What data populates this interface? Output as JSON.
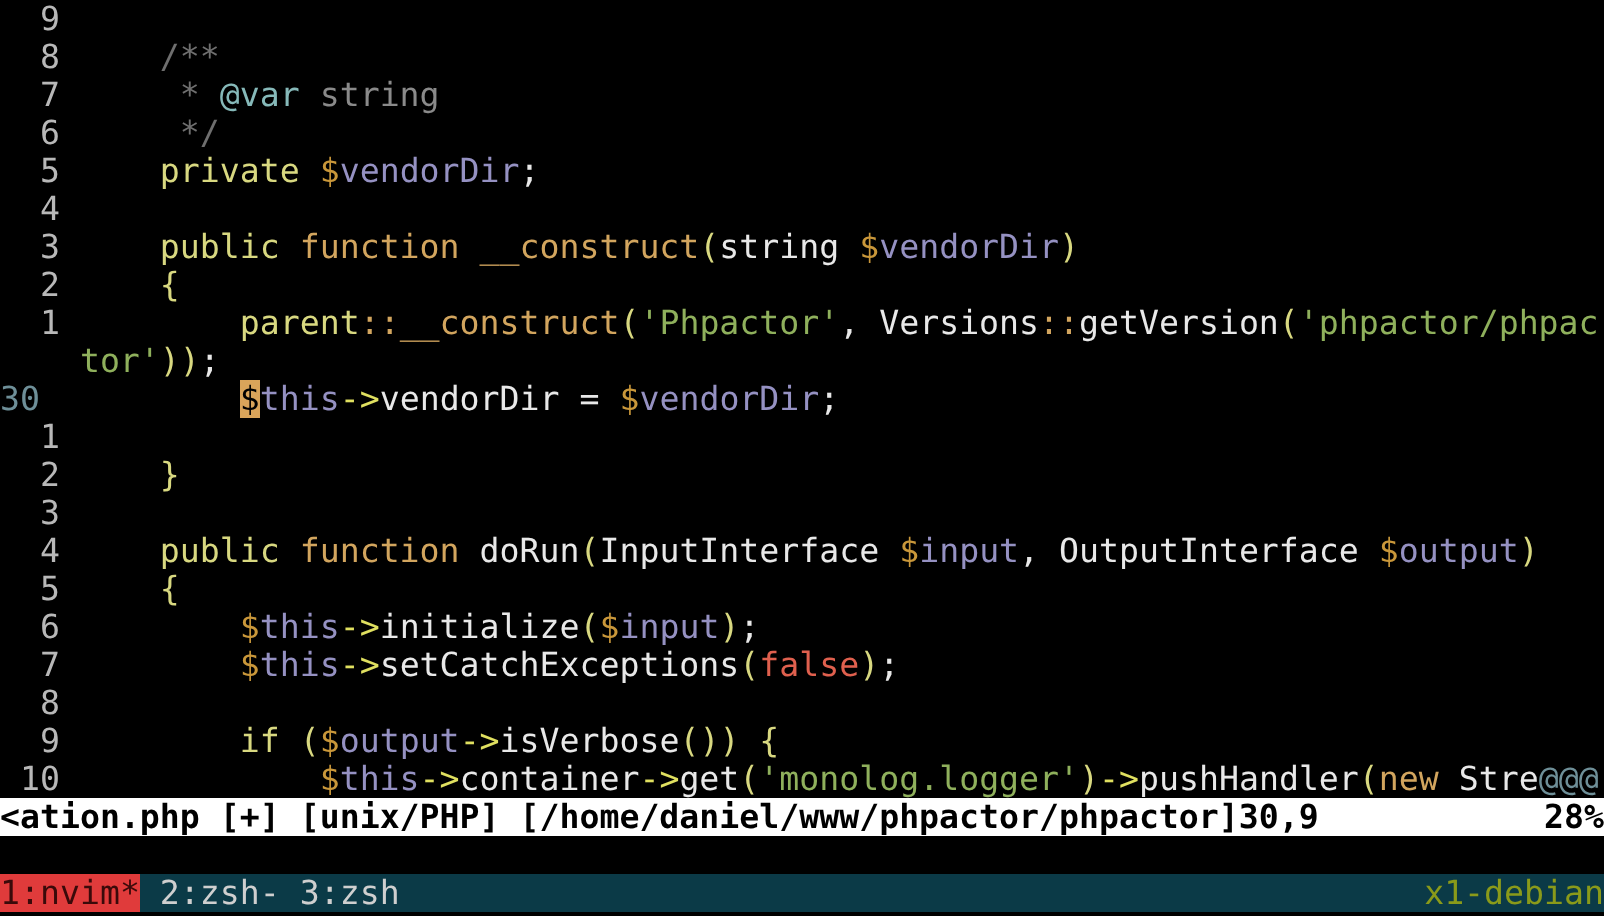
{
  "editor": {
    "lines": [
      {
        "number": "9",
        "current": false
      },
      {
        "number": "8",
        "current": false,
        "segments": [
          {
            "kind": "comment",
            "text": "    /**"
          }
        ]
      },
      {
        "number": "7",
        "current": false,
        "segments": [
          {
            "kind": "comment",
            "text": "     * "
          },
          {
            "kind": "doctag",
            "text": "@var"
          },
          {
            "kind": "doctype",
            "text": " string"
          }
        ]
      },
      {
        "number": "6",
        "current": false,
        "segments": [
          {
            "kind": "comment",
            "text": "     */"
          }
        ]
      },
      {
        "number": "5",
        "current": false,
        "segments": [
          {
            "kind": "keyword",
            "text": "    private "
          },
          {
            "kind": "sigil",
            "text": "$"
          },
          {
            "kind": "variable",
            "text": "vendorDir"
          },
          {
            "kind": "plain",
            "text": ";"
          }
        ]
      },
      {
        "number": "4",
        "current": false
      },
      {
        "number": "3",
        "current": false,
        "segments": [
          {
            "kind": "keyword",
            "text": "    public "
          },
          {
            "kind": "function",
            "text": "function __construct"
          },
          {
            "kind": "paren",
            "text": "("
          },
          {
            "kind": "plain",
            "text": "string "
          },
          {
            "kind": "sigil",
            "text": "$"
          },
          {
            "kind": "variable",
            "text": "vendorDir"
          },
          {
            "kind": "paren",
            "text": ")"
          }
        ]
      },
      {
        "number": "2",
        "current": false,
        "segments": [
          {
            "kind": "paren",
            "text": "    {"
          }
        ]
      },
      {
        "number": "1",
        "current": false,
        "segments": [
          {
            "kind": "keyword",
            "text": "        parent"
          },
          {
            "kind": "operator",
            "text": "::"
          },
          {
            "kind": "function",
            "text": "__construct"
          },
          {
            "kind": "paren",
            "text": "("
          },
          {
            "kind": "string",
            "text": "'Phpactor'"
          },
          {
            "kind": "plain",
            "text": ", Versions"
          },
          {
            "kind": "operator",
            "text": "::"
          },
          {
            "kind": "plain",
            "text": "getVersion"
          },
          {
            "kind": "paren",
            "text": "("
          },
          {
            "kind": "string",
            "text": "'phpactor/phpac"
          }
        ]
      },
      {
        "segments": [
          {
            "kind": "string",
            "text": "tor'"
          },
          {
            "kind": "paren",
            "text": "))"
          },
          {
            "kind": "plain",
            "text": ";"
          }
        ]
      },
      {
        "number": "30",
        "current": true,
        "segments": [
          {
            "kind": "sigil",
            "text": "        $",
            "cursor": true
          },
          {
            "kind": "variable",
            "text": "this"
          },
          {
            "kind": "arrow",
            "text": "->"
          },
          {
            "kind": "plain",
            "text": "vendorDir = "
          },
          {
            "kind": "sigil",
            "text": "$"
          },
          {
            "kind": "variable",
            "text": "vendorDir"
          },
          {
            "kind": "plain",
            "text": ";"
          }
        ]
      },
      {
        "number": "1",
        "current": false
      },
      {
        "number": "2",
        "current": false,
        "segments": [
          {
            "kind": "paren",
            "text": "    }"
          }
        ]
      },
      {
        "number": "3",
        "current": false
      },
      {
        "number": "4",
        "current": false,
        "segments": [
          {
            "kind": "keyword",
            "text": "    public "
          },
          {
            "kind": "function",
            "text": "function "
          },
          {
            "kind": "plain",
            "text": "doRun"
          },
          {
            "kind": "paren",
            "text": "("
          },
          {
            "kind": "plain",
            "text": "InputInterface "
          },
          {
            "kind": "sigil",
            "text": "$"
          },
          {
            "kind": "variable",
            "text": "input"
          },
          {
            "kind": "plain",
            "text": ", OutputInterface "
          },
          {
            "kind": "sigil",
            "text": "$"
          },
          {
            "kind": "variable",
            "text": "output"
          },
          {
            "kind": "paren",
            "text": ")"
          }
        ]
      },
      {
        "number": "5",
        "current": false,
        "segments": [
          {
            "kind": "paren",
            "text": "    {"
          }
        ]
      },
      {
        "number": "6",
        "current": false,
        "segments": [
          {
            "kind": "sigil",
            "text": "        $"
          },
          {
            "kind": "variable",
            "text": "this"
          },
          {
            "kind": "arrow",
            "text": "->"
          },
          {
            "kind": "plain",
            "text": "initialize"
          },
          {
            "kind": "paren",
            "text": "("
          },
          {
            "kind": "sigil",
            "text": "$"
          },
          {
            "kind": "variable",
            "text": "input"
          },
          {
            "kind": "paren",
            "text": ")"
          },
          {
            "kind": "plain",
            "text": ";"
          }
        ]
      },
      {
        "number": "7",
        "current": false,
        "segments": [
          {
            "kind": "sigil",
            "text": "        $"
          },
          {
            "kind": "variable",
            "text": "this"
          },
          {
            "kind": "arrow",
            "text": "->"
          },
          {
            "kind": "plain",
            "text": "setCatchExceptions"
          },
          {
            "kind": "paren",
            "text": "("
          },
          {
            "kind": "boolean",
            "text": "false"
          },
          {
            "kind": "paren",
            "text": ")"
          },
          {
            "kind": "plain",
            "text": ";"
          }
        ]
      },
      {
        "number": "8",
        "current": false
      },
      {
        "number": "9",
        "current": false,
        "segments": [
          {
            "kind": "keyword",
            "text": "        if "
          },
          {
            "kind": "paren",
            "text": "("
          },
          {
            "kind": "sigil",
            "text": "$"
          },
          {
            "kind": "variable",
            "text": "output"
          },
          {
            "kind": "arrow",
            "text": "->"
          },
          {
            "kind": "plain",
            "text": "isVerbose"
          },
          {
            "kind": "paren",
            "text": "()) {"
          }
        ]
      },
      {
        "number": "10",
        "current": false,
        "segments": [
          {
            "kind": "sigil",
            "text": "            $"
          },
          {
            "kind": "variable",
            "text": "this"
          },
          {
            "kind": "arrow",
            "text": "->"
          },
          {
            "kind": "plain",
            "text": "container"
          },
          {
            "kind": "arrow",
            "text": "->"
          },
          {
            "kind": "plain",
            "text": "get"
          },
          {
            "kind": "paren",
            "text": "("
          },
          {
            "kind": "string",
            "text": "'monolog.logger'"
          },
          {
            "kind": "paren",
            "text": ")"
          },
          {
            "kind": "arrow",
            "text": "->"
          },
          {
            "kind": "plain",
            "text": "pushHandler"
          },
          {
            "kind": "paren",
            "text": "("
          },
          {
            "kind": "function",
            "text": "new "
          },
          {
            "kind": "plain",
            "text": "Stre"
          },
          {
            "kind": "nontext",
            "text": "@@@"
          }
        ]
      }
    ]
  },
  "status_line": {
    "file_info": "<ation.php [+] [unix/PHP] [/home/daniel/www/phpactor/phpactor]30,9",
    "percent": "28%"
  },
  "tmux_bar": {
    "windows": [
      {
        "label": "1:nvim*",
        "selected": true
      },
      {
        "label": "2:zsh-",
        "selected": false
      },
      {
        "label": "3:zsh",
        "selected": false
      }
    ],
    "host": "x1-debian"
  }
}
